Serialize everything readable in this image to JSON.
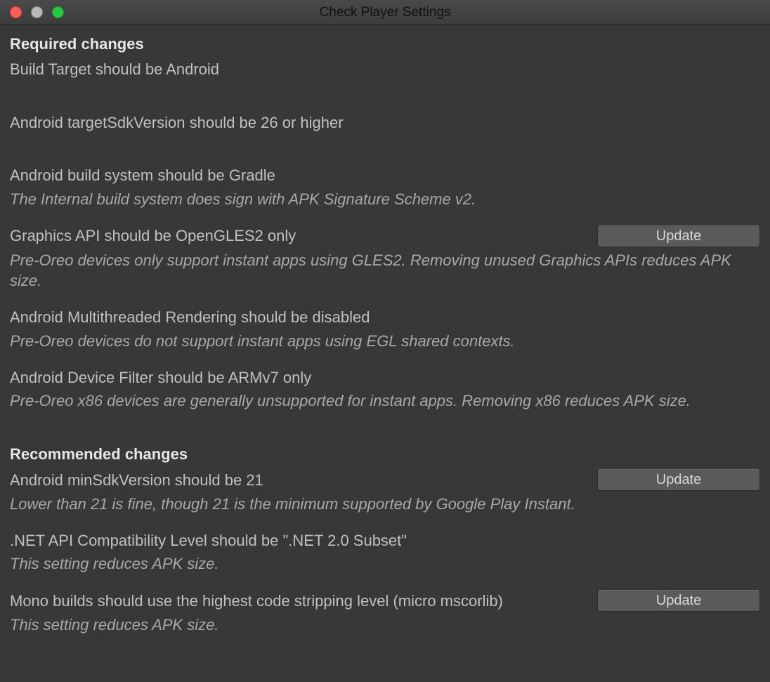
{
  "window": {
    "title": "Check Player Settings"
  },
  "buttons": {
    "update": "Update"
  },
  "sections": {
    "required": {
      "header": "Required changes",
      "items": [
        {
          "title": "Build Target should be Android",
          "desc": null,
          "hasUpdate": false
        },
        {
          "title": "Android targetSdkVersion should be 26 or higher",
          "desc": null,
          "hasUpdate": false
        },
        {
          "title": "Android build system should be Gradle",
          "desc": "The Internal build system does sign with APK Signature Scheme v2.",
          "hasUpdate": false
        },
        {
          "title": "Graphics API should be OpenGLES2 only",
          "desc": "Pre-Oreo devices only support instant apps using GLES2. Removing unused Graphics APIs reduces APK size.",
          "hasUpdate": true
        },
        {
          "title": "Android Multithreaded Rendering should be disabled",
          "desc": "Pre-Oreo devices do not support instant apps using EGL shared contexts.",
          "hasUpdate": false
        },
        {
          "title": "Android Device Filter should be ARMv7 only",
          "desc": "Pre-Oreo x86 devices are generally unsupported for instant apps. Removing x86 reduces APK size.",
          "hasUpdate": false
        }
      ]
    },
    "recommended": {
      "header": "Recommended changes",
      "items": [
        {
          "title": "Android minSdkVersion should be 21",
          "desc": "Lower than 21 is fine, though 21 is the minimum supported by Google Play Instant.",
          "hasUpdate": true
        },
        {
          "title": ".NET API Compatibility Level should be \".NET 2.0 Subset\"",
          "desc": "This setting reduces APK size.",
          "hasUpdate": false
        },
        {
          "title": "Mono builds should use the highest code stripping level (micro mscorlib)",
          "desc": "This setting reduces APK size.",
          "hasUpdate": true
        }
      ]
    }
  }
}
